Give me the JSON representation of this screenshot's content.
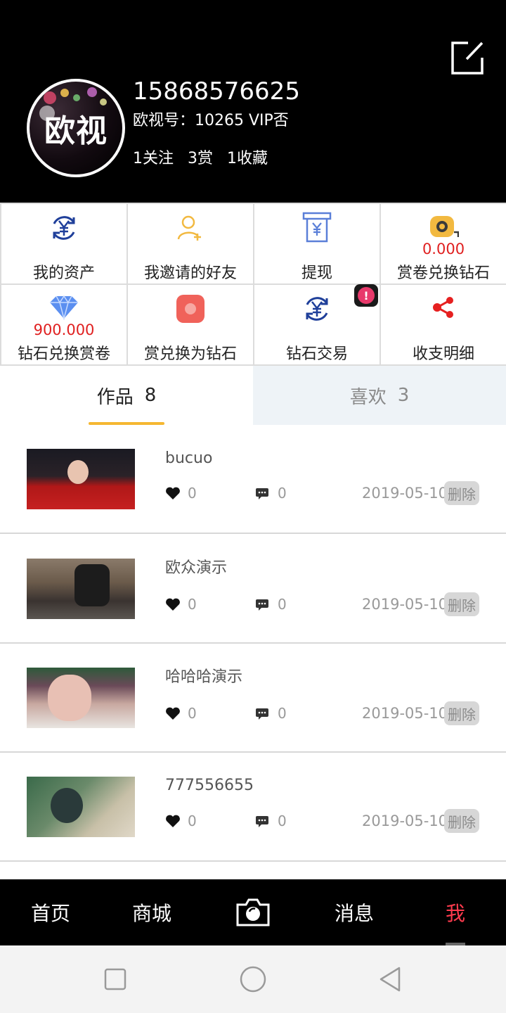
{
  "profile": {
    "avatar_text": "欧视",
    "phone": "15868576625",
    "account": "欧视号：10265 VIP否",
    "stats": [
      "1关注",
      "3赏",
      "1收藏"
    ]
  },
  "menu": {
    "items": [
      {
        "label": "我的资产",
        "icon": "yen-exchange-icon"
      },
      {
        "label": "我邀请的好友",
        "icon": "add-user-icon"
      },
      {
        "label": "提现",
        "icon": "withdraw-box-icon"
      },
      {
        "label": "赏卷兑换钻石",
        "icon": "tape-measure-icon",
        "amount": "0.000"
      },
      {
        "label": "钻石兑换赏卷",
        "icon": "diamond-icon",
        "amount": "900.000"
      },
      {
        "label": "赏兑换为钻石",
        "icon": "red-square-icon"
      },
      {
        "label": "钻石交易",
        "icon": "yen-exchange-icon"
      },
      {
        "label": "收支明细",
        "icon": "share-nodes-icon"
      }
    ],
    "badge": "!"
  },
  "tabs": {
    "works_label": "作品",
    "works_count": "8",
    "likes_label": "喜欢",
    "likes_count": "3"
  },
  "works": [
    {
      "title": "bucuo",
      "likes": "0",
      "comments": "0",
      "date": "2019-05-10",
      "delete_label": "删除"
    },
    {
      "title": "欧众演示",
      "likes": "0",
      "comments": "0",
      "date": "2019-05-10",
      "delete_label": "删除"
    },
    {
      "title": "哈哈哈演示",
      "likes": "0",
      "comments": "0",
      "date": "2019-05-10",
      "delete_label": "删除"
    },
    {
      "title": "777556655",
      "likes": "0",
      "comments": "0",
      "date": "2019-05-10",
      "delete_label": "删除"
    }
  ],
  "nav": {
    "home": "首页",
    "mall": "商城",
    "camera_icon": "camera-icon",
    "messages": "消息",
    "me": "我"
  },
  "colors": {
    "header_bg": "#000000",
    "accent_red": "#e02020",
    "nav_active": "#ff3b4e",
    "tab_underline": "#f5b731",
    "likes_tab_bg": "#eef3f7"
  }
}
